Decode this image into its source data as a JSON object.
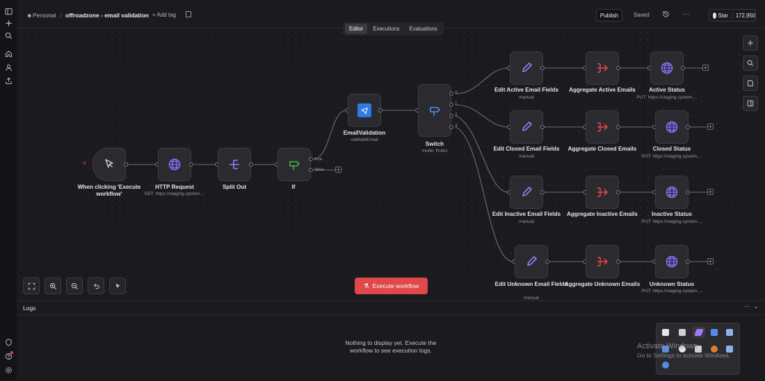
{
  "header": {
    "breadcrumb_personal": "Personal",
    "separator": "/",
    "workflow_name": "offroadzone - email validation",
    "add_tag": "+ Add tag",
    "publish": "Publish",
    "saved": "Saved",
    "more": "···",
    "github_star": "Star",
    "star_count": "172,950"
  },
  "tabs": [
    "Editor",
    "Executions",
    "Evaluations"
  ],
  "nodes": {
    "trigger": {
      "label": "When clicking 'Execute workflow'",
      "icon": "cursor-icon"
    },
    "http": {
      "label": "HTTP Request",
      "sub": "GET: https://staging.system...."
    },
    "split": {
      "label": "Split Out"
    },
    "if": {
      "label": "If",
      "true_label": "true",
      "false_label": "false"
    },
    "email_validation": {
      "label": "EmailValidation",
      "sub": "validateEmail"
    },
    "switch": {
      "label": "Switch",
      "sub": "mode: Rules",
      "outputs": [
        "0",
        "1",
        "2",
        "3"
      ]
    },
    "edit_active": {
      "label": "Edit Active Email Fields",
      "sub": "manual"
    },
    "edit_closed": {
      "label": "Edit Closed Email Fields",
      "sub": "manual"
    },
    "edit_inactive": {
      "label": "Edit Inactive Email Fields",
      "sub": "manual"
    },
    "edit_unknown": {
      "label": "Edit Unknown Email Fields",
      "sub": "manual"
    },
    "agg_active": {
      "label": "Aggregate Active Emails"
    },
    "agg_closed": {
      "label": "Aggregate Closed Emails"
    },
    "agg_inactive": {
      "label": "Aggregate Inactive Emails"
    },
    "agg_unknown": {
      "label": "Aggregate Unknown Emails"
    },
    "status_active": {
      "label": "Active Status",
      "sub": "PUT: https://staging.system...."
    },
    "status_closed": {
      "label": "Closed Status",
      "sub": "PUT: https://staging.system...."
    },
    "status_inactive": {
      "label": "Inactive Status",
      "sub": "PUT: https://staging.system...."
    },
    "status_unknown": {
      "label": "Unknown Status",
      "sub": "PUT: https://staging.system...."
    }
  },
  "execute_button": "Execute workflow",
  "logs": {
    "title": "Logs",
    "empty_message": "Nothing to display yet. Execute the workflow to see execution logs."
  },
  "watermark": {
    "line1": "Activate Windows",
    "line2": "Go to Settings to activate Windows."
  },
  "colors": {
    "accent_red": "#e0484a",
    "globe_purple": "#8b6cf6",
    "edit_purple": "#9d7cf7",
    "aggregate_red": "#e0484a",
    "if_green": "#3fb950",
    "switch_blue": "#4f8de8",
    "trigger_orange": "#ea4b3c"
  }
}
